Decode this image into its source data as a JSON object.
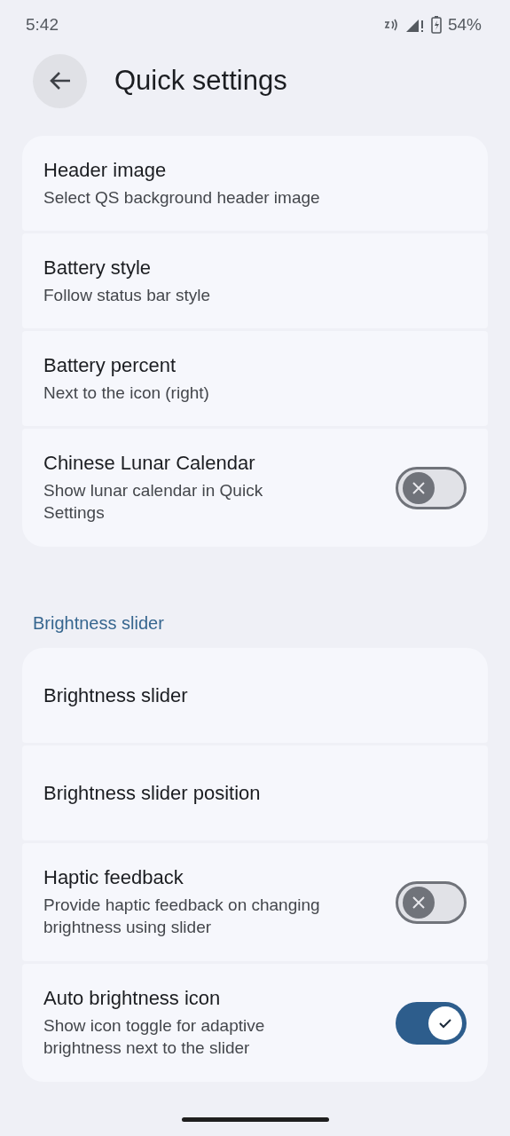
{
  "status_bar": {
    "time": "5:42",
    "battery": "54%"
  },
  "header": {
    "title": "Quick settings"
  },
  "groups": [
    {
      "items": [
        {
          "kind": "plain",
          "title": "Header image",
          "summary": "Select QS background header image"
        },
        {
          "kind": "plain",
          "title": "Battery style",
          "summary": "Follow status bar style"
        },
        {
          "kind": "plain",
          "title": "Battery percent",
          "summary": "Next to the icon (right)"
        },
        {
          "kind": "toggle",
          "title": "Chinese Lunar Calendar",
          "summary": "Show lunar calendar in Quick Settings",
          "on": false
        }
      ]
    },
    {
      "heading": "Brightness slider",
      "items": [
        {
          "kind": "plain",
          "title": "Brightness slider"
        },
        {
          "kind": "plain",
          "title": "Brightness slider position"
        },
        {
          "kind": "toggle",
          "title": "Haptic feedback",
          "summary": "Provide haptic feedback on changing brightness using slider",
          "on": false
        },
        {
          "kind": "toggle",
          "title": "Auto brightness icon",
          "summary": "Show icon toggle for adaptive brightness next to the slider",
          "on": true
        }
      ]
    }
  ]
}
